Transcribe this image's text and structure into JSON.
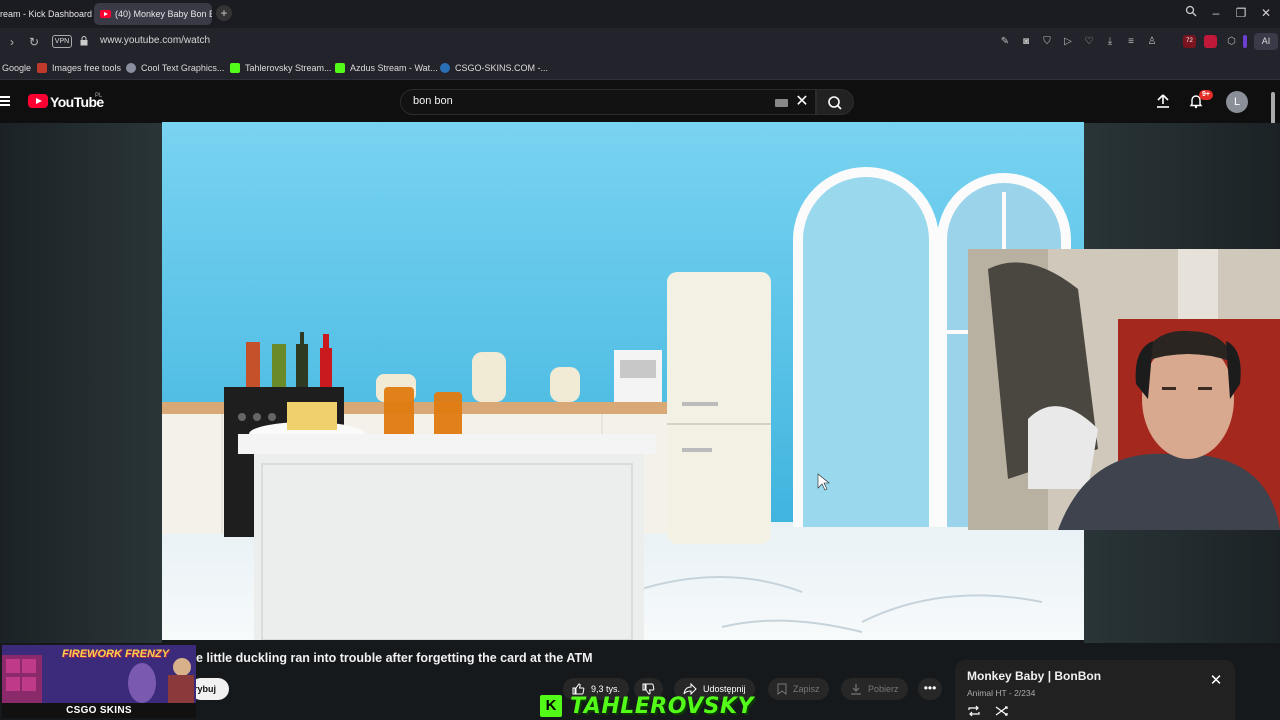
{
  "browser": {
    "tabs": [
      {
        "title": "ream - Kick Dashboard",
        "active": false
      },
      {
        "title": "(40) Monkey Baby Bon Bo",
        "active": true
      }
    ],
    "address": {
      "url": "www.youtube.com/watch",
      "vpn_label": "VPN"
    },
    "extension_badge": "72",
    "ai_label": "AI",
    "bookmarks": [
      {
        "label": "Google",
        "icon": "google-icon"
      },
      {
        "label": "Images free tools",
        "icon": "bookmark-red-icon"
      },
      {
        "label": "Cool Text Graphics...",
        "icon": "cooltext-icon"
      },
      {
        "label": "Tahlerovsky Stream...",
        "icon": "kick-icon"
      },
      {
        "label": "Azdus Stream - Wat...",
        "icon": "kick-icon"
      },
      {
        "label": "CSGO-SKINS.COM -...",
        "icon": "globe-icon"
      }
    ]
  },
  "youtube": {
    "logo_text": "YouTube",
    "country_code": "PL",
    "search_query": "bon bon",
    "notification_count": "9+",
    "avatar_letter": "L",
    "video": {
      "title": "e little duckling ran into trouble after forgetting the card at the ATM",
      "subscribe_label": "rybuj",
      "likes": "9,3 tys.",
      "share_label": "Udostępnij",
      "save_label": "Zapisz",
      "download_label": "Pobierz"
    },
    "playlist": {
      "title": "Monkey Baby | BonBon",
      "meta": "Animal HT - 2/234"
    }
  },
  "overlays": {
    "ad_title": "FIREWORK FRENZY",
    "sponsor": "CSGO SKINS",
    "streamer_name": "TAHLEROVSKY",
    "streamer_platform_letter": "K"
  },
  "colors": {
    "youtube_red": "#ff0033",
    "kick_green": "#53fc18",
    "video_sky": "#7dd4f0"
  }
}
